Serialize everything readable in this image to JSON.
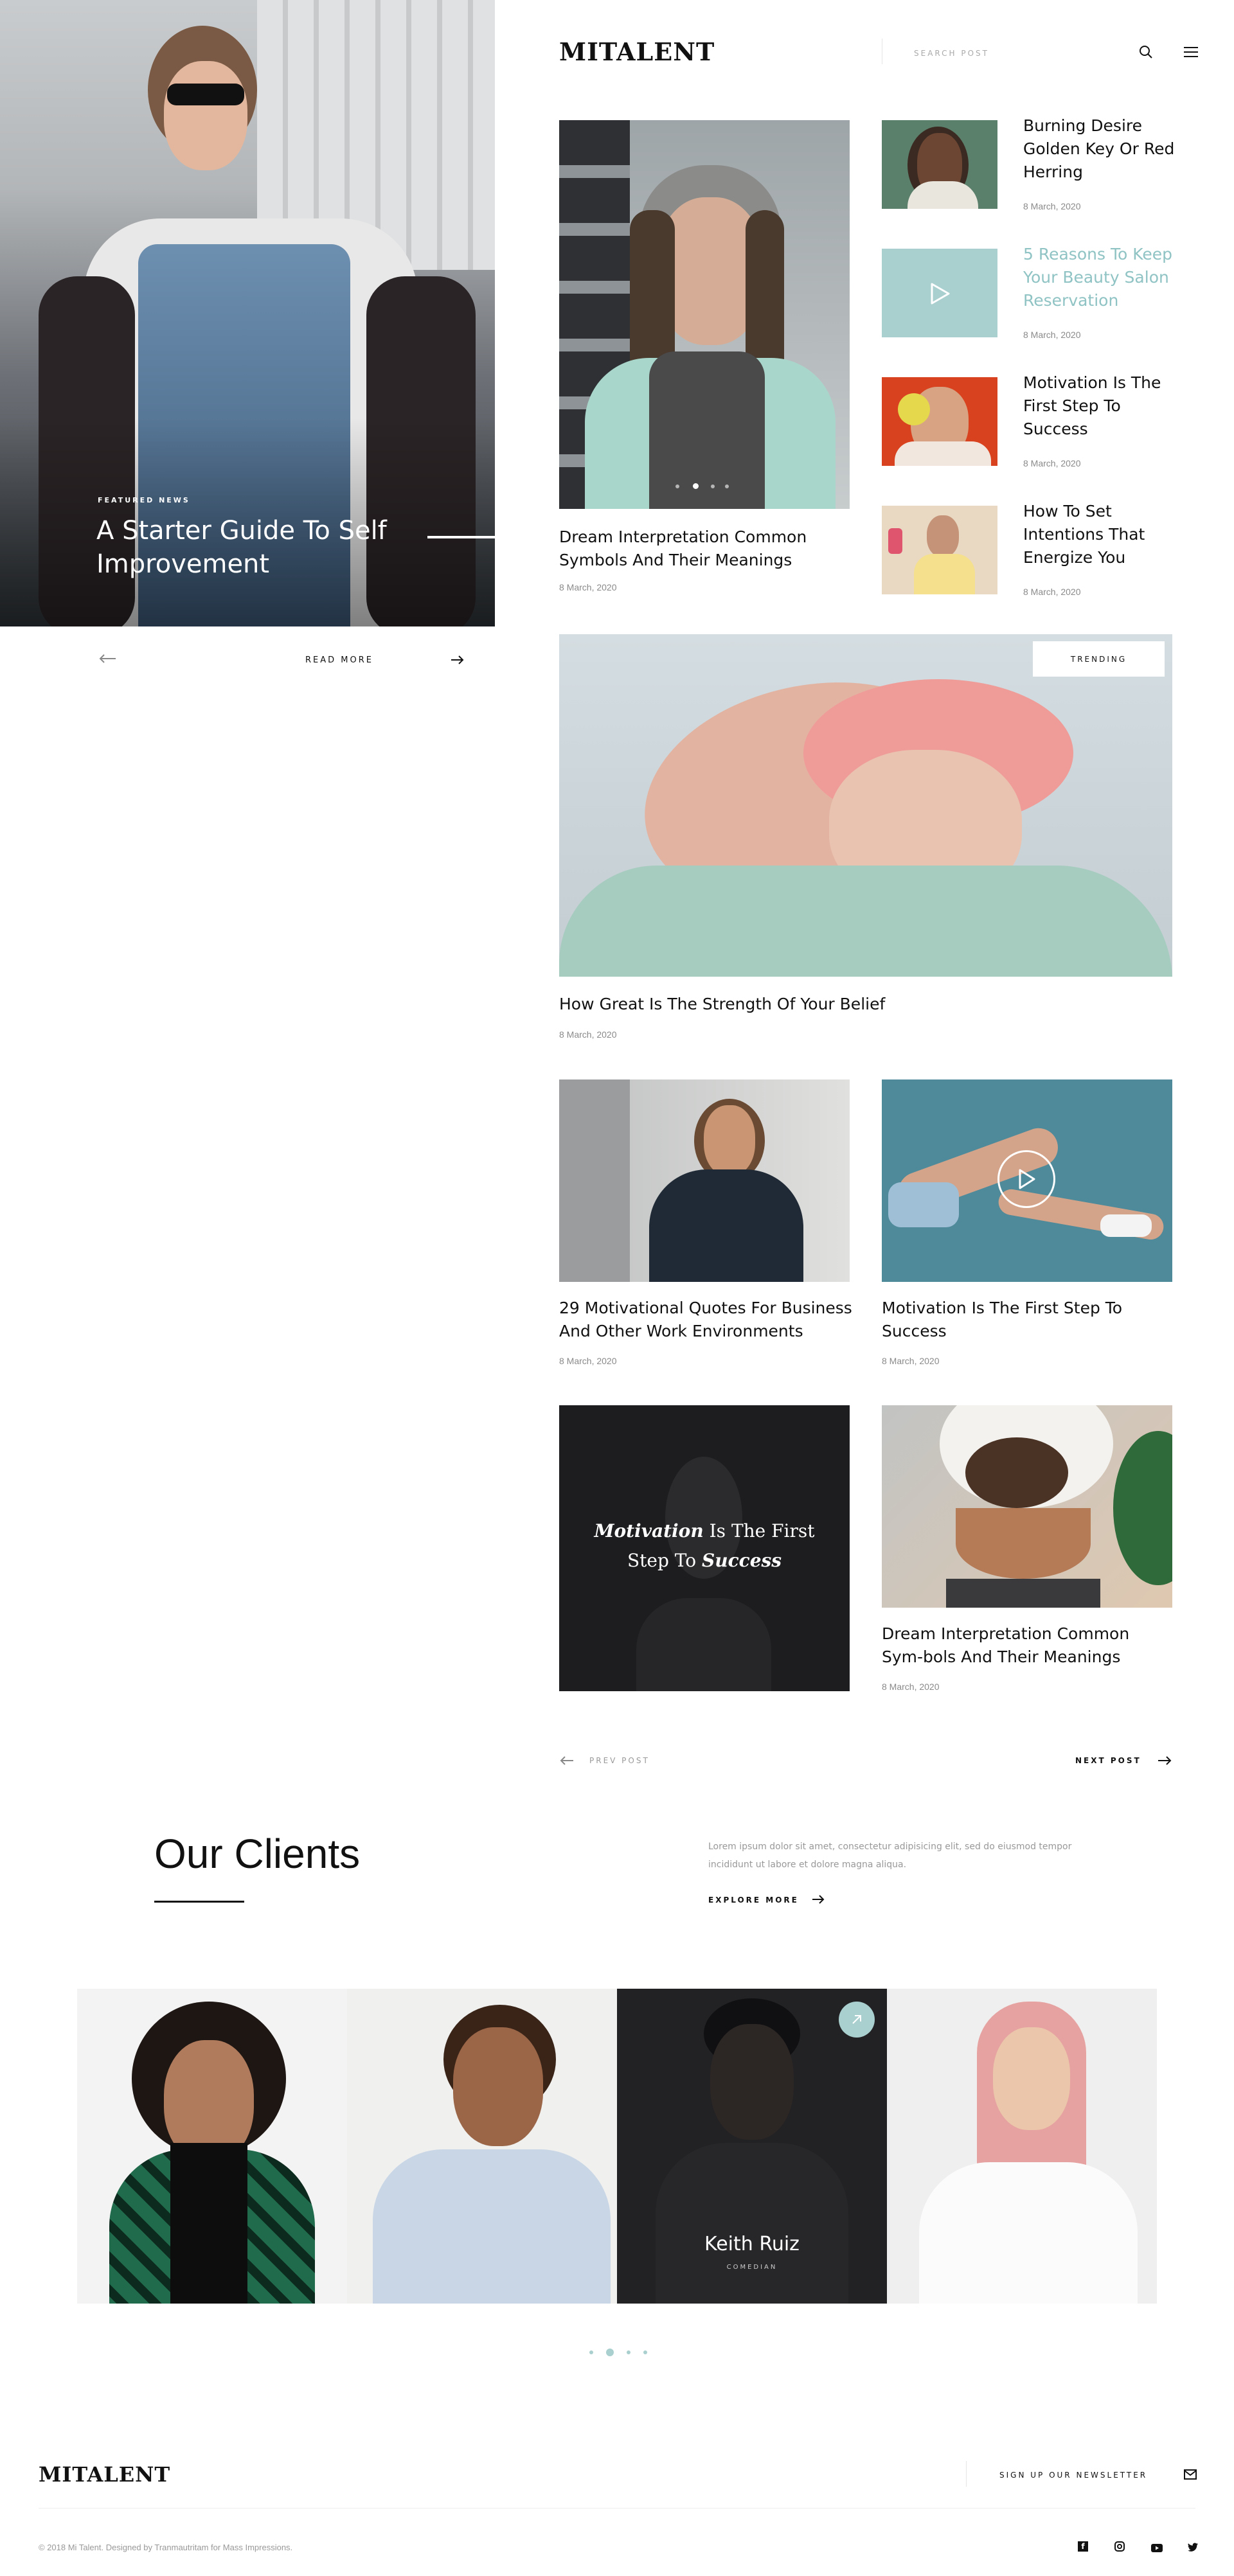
{
  "hero": {
    "label": "FEATURED NEWS",
    "title": "A Starter Guide To Self Improvement",
    "read_more": "READ MORE"
  },
  "header": {
    "logo": "MITALENT",
    "search_placeholder": "SEARCH POST"
  },
  "featured": {
    "title": "Dream Interpretation Common Symbols And Their Meanings",
    "date": "8 March, 2020"
  },
  "side_posts": [
    {
      "title": "Burning Desire Golden Key Or Red Herring",
      "date": "8 March, 2020"
    },
    {
      "title": "5 Reasons To Keep Your Beauty Salon Reservation",
      "date": "8 March, 2020"
    },
    {
      "title": "Motivation Is The First Step To Success",
      "date": "8 March, 2020"
    },
    {
      "title": "How To Set Intentions That Energize You",
      "date": "8 March, 2020"
    }
  ],
  "trending": {
    "badge": "TRENDING",
    "title": "How Great Is The Strength Of Your Belief",
    "date": "8 March, 2020"
  },
  "grid": [
    {
      "title": "29 Motivational Quotes For Business And Other Work Environments",
      "date": "8 March, 2020"
    },
    {
      "title": "Motivation Is The First Step To Success",
      "date": "8 March, 2020"
    }
  ],
  "quote_card": {
    "emph1": "Motivation",
    "text1": " Is The First",
    "text2": "Step To ",
    "emph2": "Success"
  },
  "grid2": {
    "title": "Dream Interpretation Common Sym-bols And Their Meanings",
    "date": "8 March, 2020"
  },
  "pager": {
    "prev": "PREV POST",
    "next": "NEXT POST"
  },
  "clients": {
    "heading": "Our Clients",
    "text": "Lorem ipsum dolor sit amet, consectetur adipisicing elit, sed do eiusmod tempor incididunt ut labore et dolore magna aliqua.",
    "explore": "EXPLORE MORE",
    "person_name": "Keith Ruiz",
    "person_role": "COMEDIAN"
  },
  "footer": {
    "logo": "MITALENT",
    "newsletter": "SIGN UP OUR NEWSLETTER",
    "copyright": "© 2018 Mi Talent. Designed by Tranmautritam for Mass Impressions."
  },
  "colors": {
    "accent": "#8fc3c4",
    "dark": "#1d1d1f",
    "mint": "#a9cfce"
  },
  "icons": [
    "search-icon",
    "menu-icon",
    "play-icon",
    "arrow-left-icon",
    "arrow-right-icon",
    "arrow-up-right-icon",
    "mail-icon",
    "facebook-icon",
    "instagram-icon",
    "youtube-icon",
    "twitter-icon"
  ]
}
